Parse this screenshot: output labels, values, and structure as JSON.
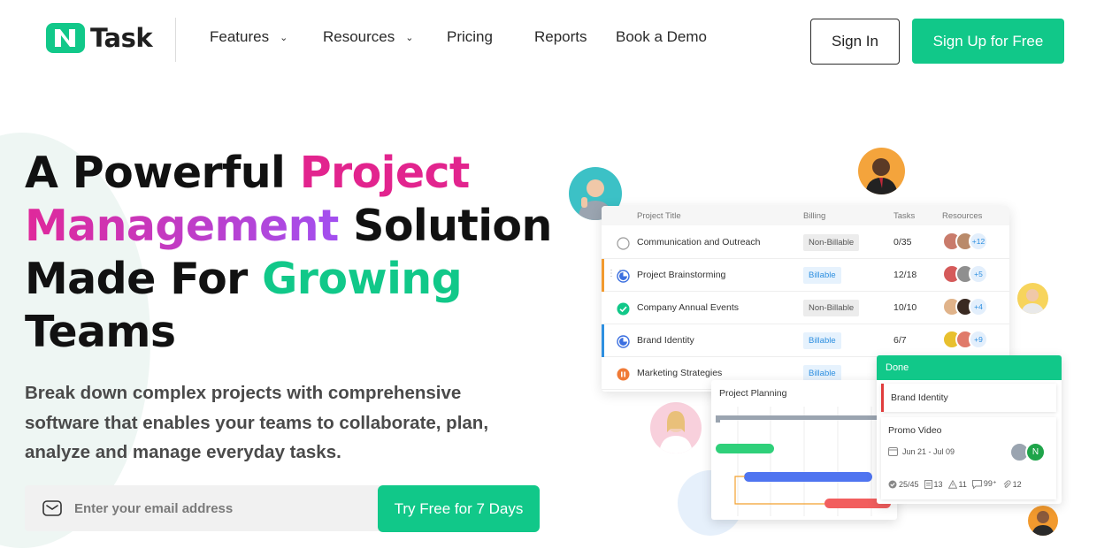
{
  "brand": {
    "name": "Task",
    "accent": "#11c889",
    "pink": "#e2248e"
  },
  "nav": {
    "items": [
      {
        "label": "Features",
        "dropdown": true
      },
      {
        "label": "Resources",
        "dropdown": true
      },
      {
        "label": "Pricing",
        "dropdown": false
      },
      {
        "label": "Reports",
        "dropdown": false
      },
      {
        "label": "Book a Demo",
        "dropdown": false
      }
    ],
    "signin": "Sign In",
    "signup": "Sign Up for Free"
  },
  "hero": {
    "line1_a": "A Powerful ",
    "line1_b": "Project",
    "line2_a": "Management",
    "line2_b": " Solution",
    "line3_a": "Made For ",
    "line3_b": "Growing",
    "line4": "Teams",
    "subtitle": "Break down complex projects with comprehensive software that enables your teams to collaborate, plan, analyze and manage everyday tasks.",
    "email_placeholder": "Enter your email address",
    "cta": "Try Free for 7 Days"
  },
  "table": {
    "headers": [
      "Project Title",
      "Billing",
      "Tasks",
      "Resources"
    ],
    "rows": [
      {
        "title": "Communication and Outreach",
        "billing": "Non-Billable",
        "tasks": "0/35",
        "more": "+12",
        "status": "empty"
      },
      {
        "title": "Project Brainstorming",
        "billing": "Billable",
        "tasks": "12/18",
        "more": "+5",
        "status": "progress"
      },
      {
        "title": "Company Annual Events",
        "billing": "Non-Billable",
        "tasks": "10/10",
        "more": "+4",
        "status": "done"
      },
      {
        "title": "Brand Identity",
        "billing": "Billable",
        "tasks": "6/7",
        "more": "+9",
        "status": "progress"
      },
      {
        "title": "Marketing Strategies",
        "billing": "Billable",
        "tasks": "",
        "more": "",
        "status": "paused"
      }
    ]
  },
  "gantt": {
    "title": "Project Planning"
  },
  "kanban": {
    "column": "Done",
    "card1": "Brand Identity",
    "card2": {
      "title": "Promo Video",
      "date": "Jun 21 - Jul 09",
      "avatar_letter": "N",
      "stats": {
        "checklist": "25/45",
        "notes": "13",
        "issues": "11",
        "comments": "99⁺",
        "attachments": "12"
      }
    }
  }
}
